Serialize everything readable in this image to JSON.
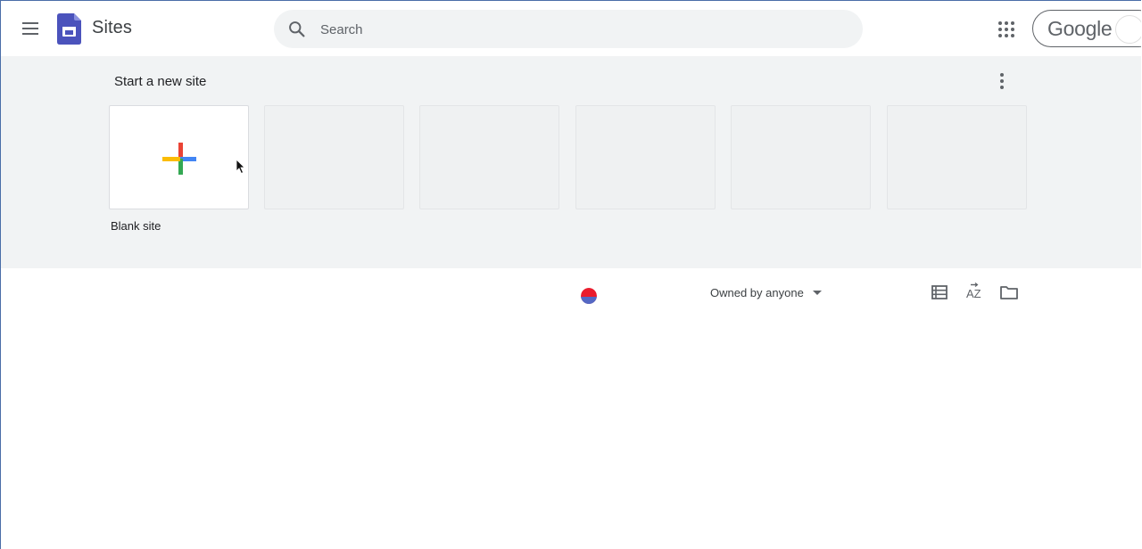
{
  "header": {
    "app_title": "Sites",
    "search_placeholder": "Search",
    "account_brand": "Google",
    "icons": {
      "menu": "hamburger-menu-icon",
      "logo": "google-sites-logo-icon",
      "search": "search-icon",
      "apps": "apps-grid-icon"
    },
    "logo_color": "#4b53bc"
  },
  "templates": {
    "title": "Start a new site",
    "more_icon": "more-vert-icon",
    "blank_label": "Blank site",
    "placeholder_tile_count": 5,
    "plus_colors": {
      "top": "#ea4335",
      "right": "#4285f4",
      "bottom": "#34a853",
      "left": "#fbbc04"
    }
  },
  "toolbar": {
    "owner_filter_label": "Owned by anyone",
    "icons": {
      "list_view": "list-view-icon",
      "sort": "sort-az-icon",
      "folder": "folder-icon",
      "loading": "loading-spinner-icon"
    }
  }
}
